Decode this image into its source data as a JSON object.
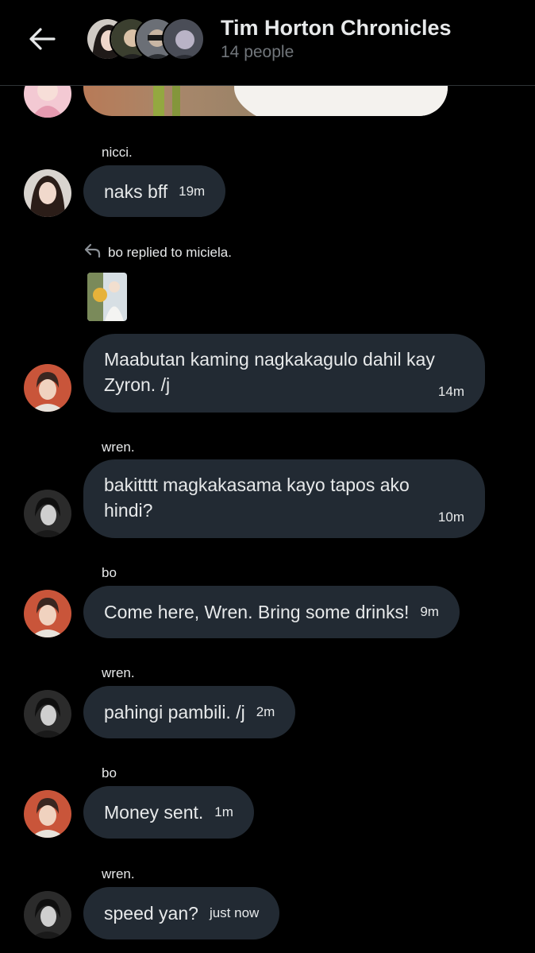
{
  "header": {
    "title": "Tim Horton Chronicles",
    "subtitle": "14 people"
  },
  "reply": {
    "text": "bo replied to miciela."
  },
  "messages": [
    {
      "sender": "nicci.",
      "text": "naks bff",
      "time": "19m"
    },
    {
      "sender": "",
      "text": "Maabutan kaming nagkakagulo dahil kay Zyron. /j",
      "time": "14m"
    },
    {
      "sender": "wren.",
      "text": "bakitttt magkakasama kayo tapos ako hindi?",
      "time": "10m"
    },
    {
      "sender": "bo",
      "text": "Come here, Wren. Bring some drinks!",
      "time": "9m"
    },
    {
      "sender": "wren.",
      "text": "pahingi pambili. /j",
      "time": "2m"
    },
    {
      "sender": "bo",
      "text": "Money sent.",
      "time": "1m"
    },
    {
      "sender": "wren.",
      "text": "speed yan?",
      "time": "just now"
    }
  ],
  "icons": {
    "back": "arrow-left-icon",
    "reply": "reply-arrow-icon"
  }
}
